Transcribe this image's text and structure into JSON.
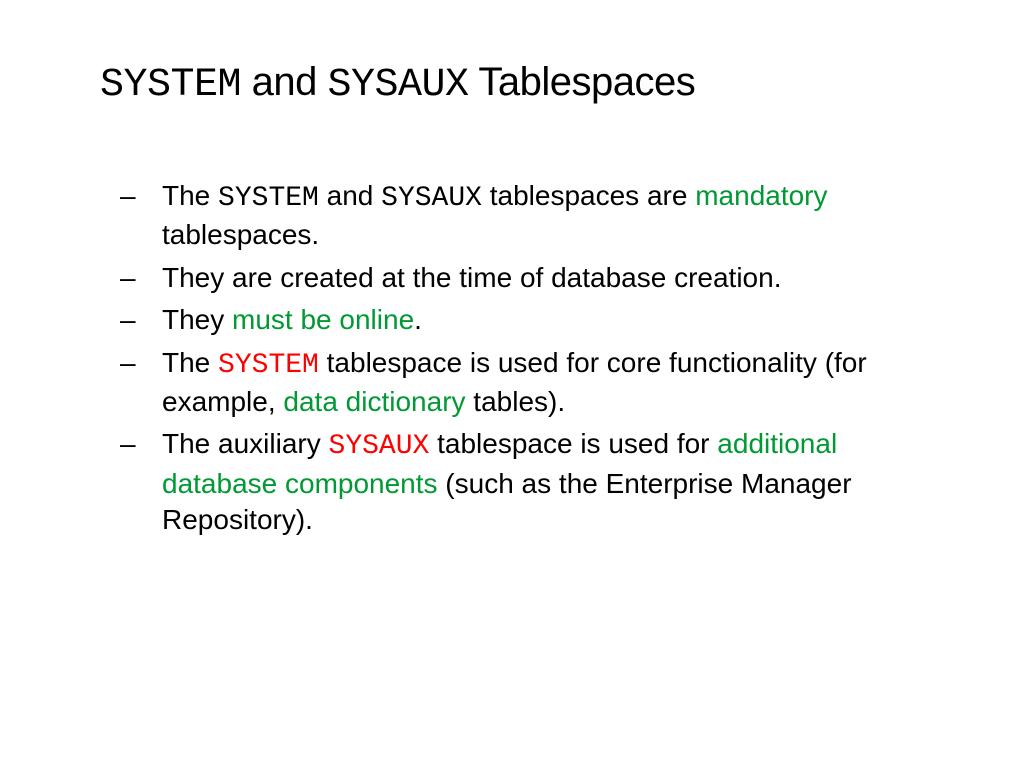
{
  "title": {
    "part1_mono": "SYSTEM",
    "part2": " and ",
    "part3_mono": "SYSAUX",
    "part4": " Tablespaces"
  },
  "bullets": [
    {
      "segments": [
        {
          "text": "The ",
          "cls": ""
        },
        {
          "text": "SYSTEM",
          "cls": "mono"
        },
        {
          "text": " and ",
          "cls": ""
        },
        {
          "text": "SYSAUX",
          "cls": "mono"
        },
        {
          "text": " tablespaces are ",
          "cls": ""
        },
        {
          "text": "mandatory",
          "cls": "green"
        },
        {
          "text": " tablespaces.",
          "cls": ""
        }
      ]
    },
    {
      "segments": [
        {
          "text": "They are created at the time of database creation.",
          "cls": ""
        }
      ]
    },
    {
      "segments": [
        {
          "text": "They ",
          "cls": ""
        },
        {
          "text": "must be online",
          "cls": "green"
        },
        {
          "text": ".",
          "cls": ""
        }
      ]
    },
    {
      "segments": [
        {
          "text": "The ",
          "cls": ""
        },
        {
          "text": "SYSTEM",
          "cls": "mono red"
        },
        {
          "text": " tablespace is used for core functionality (for example, ",
          "cls": ""
        },
        {
          "text": "data dictionary",
          "cls": "green"
        },
        {
          "text": " tables).",
          "cls": ""
        }
      ]
    },
    {
      "segments": [
        {
          "text": "The auxiliary ",
          "cls": ""
        },
        {
          "text": "SYSAUX",
          "cls": "mono red"
        },
        {
          "text": " tablespace is used for ",
          "cls": ""
        },
        {
          "text": "additional database components",
          "cls": "green"
        },
        {
          "text": " (such as the Enterprise Manager Repository).",
          "cls": ""
        }
      ]
    }
  ]
}
